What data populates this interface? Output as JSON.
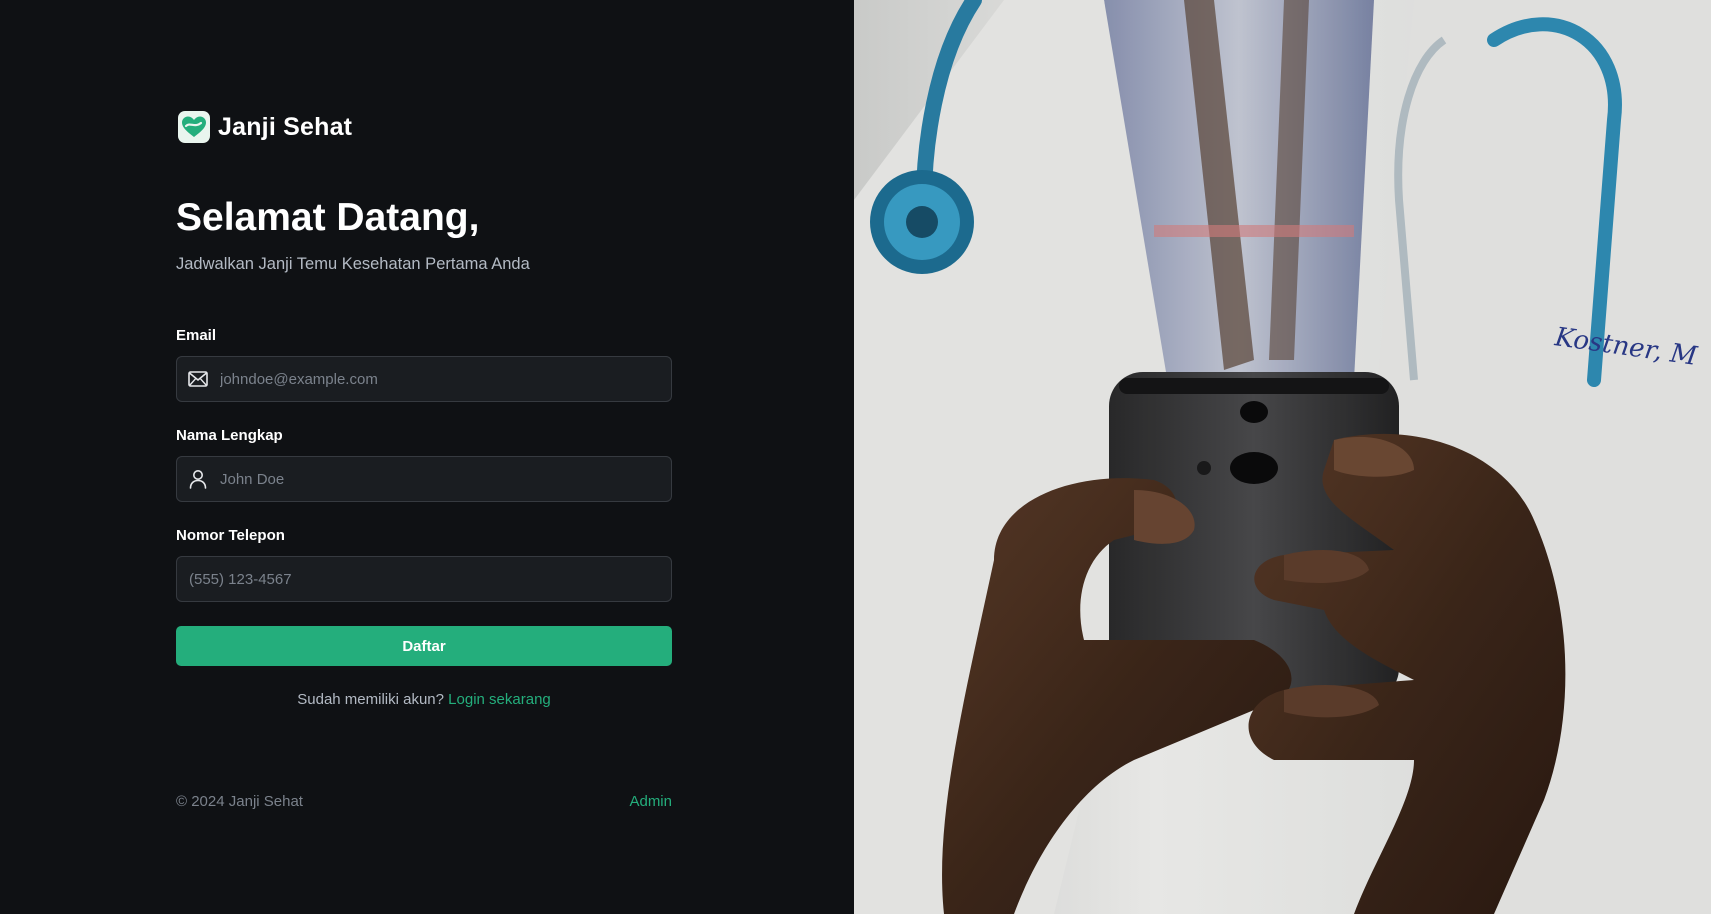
{
  "brand": {
    "name": "Janji Sehat",
    "logo_icon": "heart-icon"
  },
  "heading": {
    "title": "Selamat Datang,",
    "subtitle": "Jadwalkan Janji Temu Kesehatan Pertama Anda"
  },
  "form": {
    "email": {
      "label": "Email",
      "placeholder": "johndoe@example.com",
      "value": "",
      "icon": "mail-icon"
    },
    "name": {
      "label": "Nama Lengkap",
      "placeholder": "John Doe",
      "value": "",
      "icon": "user-icon"
    },
    "phone": {
      "label": "Nomor Telepon",
      "placeholder": "(555) 123-4567",
      "value": ""
    },
    "submit_label": "Daftar"
  },
  "login": {
    "prompt": "Sudah memiliki akun?",
    "link_label": "Login sekarang"
  },
  "footer": {
    "copyright": "© 2024 Janji Sehat",
    "admin_label": "Admin"
  },
  "colors": {
    "accent": "#24ae7c",
    "background": "#0f1114",
    "input_bg": "#1a1d21",
    "muted": "#b3bac4"
  },
  "hero_image": {
    "icon": "doctor-holding-phone-photo"
  }
}
